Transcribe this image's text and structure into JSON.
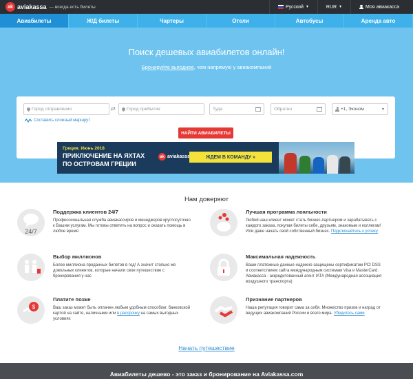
{
  "header": {
    "logo_badge": "ak",
    "logo_text": "aviakassa",
    "tagline": "— всегда есть билеты",
    "language": "Русский",
    "currency": "RUR",
    "account": "Моя авиакасса"
  },
  "nav": {
    "tabs": [
      {
        "label": "Авиабилеты",
        "active": true
      },
      {
        "label": "Ж/Д билеты"
      },
      {
        "label": "Чартеры"
      },
      {
        "label": "Отели"
      },
      {
        "label": "Автобусы"
      },
      {
        "label": "Аренда авто"
      }
    ]
  },
  "hero": {
    "title": "Поиск дешевых авиабилетов онлайн!",
    "sub_link": "Бронируйте выгоднее",
    "sub_rest": ", чем напрямую у авиакомпаний"
  },
  "search": {
    "from_placeholder": "Город отправления",
    "to_placeholder": "Город прибытия",
    "depart_placeholder": "Туда",
    "return_placeholder": "Обратно",
    "passengers": "+1, Эконом",
    "complex_route": "Составить сложный маршрут",
    "button": "НАЙТИ АВИАБИЛЕТЫ"
  },
  "banner": {
    "line1": "Греция. Июнь 2018",
    "line2": "ПРИКЛЮЧЕНИЕ НА ЯХТАХ",
    "line3": "ПО ОСТРОВАМ ГРЕЦИИ",
    "logo": "aviakassa",
    "cta": "ЖДЕМ В КОМАНДУ »"
  },
  "trust": {
    "title": "Нам доверяют",
    "features": [
      {
        "title": "Поддержка клиентов 24/7",
        "icon": "24-7-chat-icon",
        "icon_text": "24/7",
        "text": "Профессиональная служба авиакассиров и менеджеров круглосуточно к Вашим услугам. Мы готовы ответить на вопрос и оказать помощь в любое время",
        "link": ""
      },
      {
        "title": "Лучшая программа лояльности",
        "icon": "piggy-bank-icon",
        "text": "Любой наш клиент может стать бизнес-партнером и зарабатывать с каждого заказа, покупая билеты себе, друзьям, знакомым и коллегам! Или даже начать свой собственный бизнес.",
        "link": "Подключайтесь к успеху"
      },
      {
        "title": "Выбор миллионов",
        "icon": "travelers-icon",
        "text": "Более миллиона проданных билетов в год! А значит столько же довольных клиентов, которые начали свое путешествие с бронирования у нас",
        "link": ""
      },
      {
        "title": "Максимальная надежность",
        "icon": "padlock-icon",
        "text": "Ваши платежные данные надежно защищены сертификатом PCI DSS и соответствием сайта международным системам Visa и MasterCard. Авиакасса - аккредитованный агент IATA (Международная ассоциация воздушного транспорта)",
        "link": ""
      },
      {
        "title": "Платите позже",
        "icon": "payment-icon",
        "text_a": "Ваш заказ может быть оплачен любым удобным способом: банковской картой на сайте, наличными или ",
        "text_link": "в рассрочку",
        "text_b": " на самых выгодных условиях"
      },
      {
        "title": "Признание партнеров",
        "icon": "handshake-icon",
        "text": "Наша репутация говорит сама за себя. Множество призов и наград от ведущих авиакомпаний России и всего мира. ",
        "link": "Убедитесь сами"
      }
    ],
    "start_link": "Начать путешествие"
  },
  "footer": {
    "text": "Авиабилеты дешево - это заказ и бронирование на Aviakassa.com"
  },
  "colors": {
    "topbar": "#2b2e33",
    "nav": "#3eb0ea",
    "nav_active": "#1f8fd6",
    "hero": "#6ec3ef",
    "accent_red": "#e53935",
    "link": "#2a8ad0"
  }
}
